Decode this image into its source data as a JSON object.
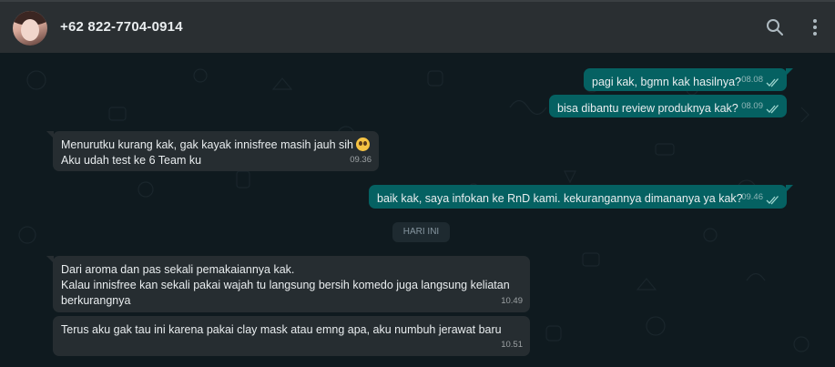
{
  "header": {
    "contact_name": "+62 822-7704-0914",
    "search_icon": "search-icon",
    "menu_icon": "kebab-menu-icon"
  },
  "colors": {
    "header_bg": "#2a2f32",
    "chat_bg": "#0f1a1f",
    "incoming_bubble": "#262d31",
    "outgoing_bubble": "#056162",
    "text": "#e9edef"
  },
  "messages": [
    {
      "direction": "out",
      "text": "pagi kak, bgmn kak hasilnya?",
      "time": "08.08",
      "status": "read"
    },
    {
      "direction": "out",
      "text": "bisa dibantu review produknya kak?",
      "time": "08.09",
      "status": "read"
    },
    {
      "direction": "in",
      "line1": "Menurutku kurang kak, gak kayak innisfree masih jauh sih",
      "emoji": "pleading-face",
      "line2": "Aku udah test ke 6 Team ku",
      "time": "09.36"
    },
    {
      "direction": "out",
      "text": "baik kak, saya infokan ke RnD kami. kekurangannya dimananya ya kak?",
      "time": "09.46",
      "status": "read"
    },
    {
      "direction": "in",
      "line1": "Dari aroma dan pas sekali pemakaiannya kak.",
      "line2": "Kalau innisfree kan sekali pakai wajah tu langsung bersih komedo juga langsung keliatan",
      "line3": "berkurangnya",
      "time": "10.49"
    },
    {
      "direction": "in",
      "text": "Terus aku gak tau ini karena pakai clay mask atau emng apa, aku numbuh jerawat baru",
      "time": "10.51"
    }
  ],
  "day_separator": "HARI INI"
}
